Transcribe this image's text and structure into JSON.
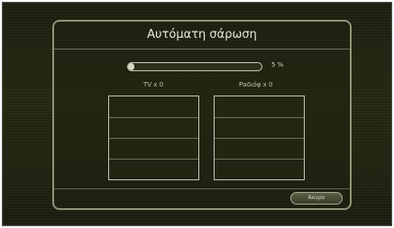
{
  "dialog": {
    "title": "Αυτόματη σάρωση",
    "progress": {
      "value_percent": 5,
      "label": "5 %"
    },
    "tv": {
      "label": "TV x 0",
      "rows": 4
    },
    "radio": {
      "label": "Ραδιόφ x 0",
      "rows": 4
    },
    "cancel_label": "Άκυρο"
  }
}
